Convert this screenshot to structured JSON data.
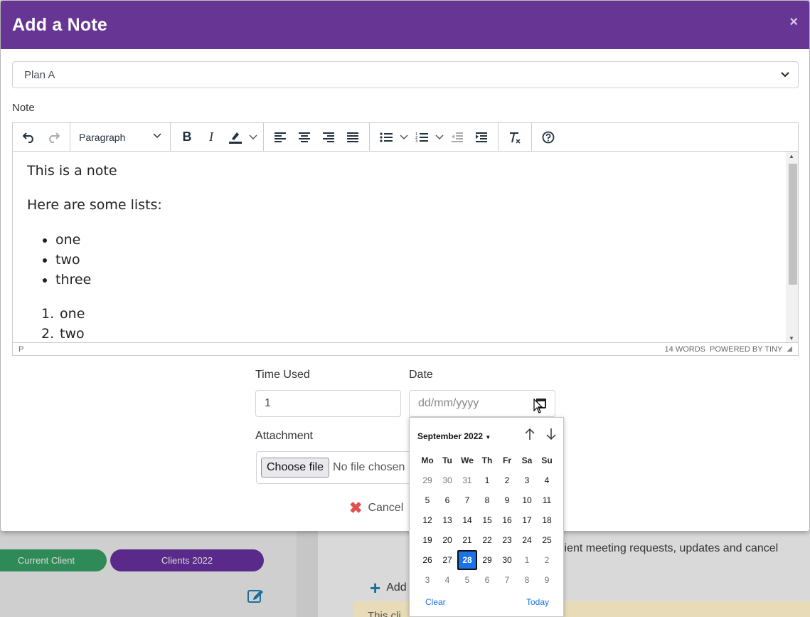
{
  "background": {
    "pill_current_client": "Current Client",
    "pill_clients_2022": "Clients 2022",
    "right_text": "lient meeting requests, updates and cancel",
    "add_text": "Add",
    "yellow_text": "This cli"
  },
  "modal": {
    "title": "Add a Note",
    "close": "×",
    "plan": {
      "selected": "Plan A"
    },
    "note_label": "Note",
    "editor": {
      "block_format": "Paragraph",
      "content": {
        "p1": "This is a note",
        "p2": "Here are some lists:",
        "bullets": [
          "one",
          "two",
          "three"
        ],
        "numbered": [
          {
            "num": "1.",
            "text": "one"
          },
          {
            "num": "2.",
            "text": "two"
          }
        ]
      },
      "status_path": "P",
      "word_count": "14 WORDS",
      "powered_by": "POWERED BY TINY"
    },
    "time_used": {
      "label": "Time Used",
      "value": "1"
    },
    "date": {
      "label": "Date",
      "placeholder": "dd/mm/yyyy"
    },
    "attachment": {
      "label": "Attachment",
      "button": "Choose file",
      "status": "No file chosen"
    },
    "cancel": "Cancel"
  },
  "datepicker": {
    "month": "September 2022",
    "weekdays": [
      "Mo",
      "Tu",
      "We",
      "Th",
      "Fr",
      "Sa",
      "Su"
    ],
    "weeks": [
      [
        {
          "d": "29",
          "m": true
        },
        {
          "d": "30",
          "m": true
        },
        {
          "d": "31",
          "m": true
        },
        {
          "d": "1"
        },
        {
          "d": "2"
        },
        {
          "d": "3"
        },
        {
          "d": "4"
        }
      ],
      [
        {
          "d": "5"
        },
        {
          "d": "6"
        },
        {
          "d": "7"
        },
        {
          "d": "8"
        },
        {
          "d": "9"
        },
        {
          "d": "10"
        },
        {
          "d": "11"
        }
      ],
      [
        {
          "d": "12"
        },
        {
          "d": "13"
        },
        {
          "d": "14"
        },
        {
          "d": "15"
        },
        {
          "d": "16"
        },
        {
          "d": "17"
        },
        {
          "d": "18"
        }
      ],
      [
        {
          "d": "19"
        },
        {
          "d": "20"
        },
        {
          "d": "21"
        },
        {
          "d": "22"
        },
        {
          "d": "23"
        },
        {
          "d": "24"
        },
        {
          "d": "25"
        }
      ],
      [
        {
          "d": "26"
        },
        {
          "d": "27"
        },
        {
          "d": "28",
          "s": true
        },
        {
          "d": "29"
        },
        {
          "d": "30"
        },
        {
          "d": "1",
          "m": true
        },
        {
          "d": "2",
          "m": true
        }
      ],
      [
        {
          "d": "3",
          "m": true
        },
        {
          "d": "4",
          "m": true
        },
        {
          "d": "5",
          "m": true
        },
        {
          "d": "6",
          "m": true
        },
        {
          "d": "7",
          "m": true
        },
        {
          "d": "8",
          "m": true
        },
        {
          "d": "9",
          "m": true
        }
      ]
    ],
    "clear": "Clear",
    "today": "Today"
  },
  "colors": {
    "header": "#673593",
    "selected_day": "#1a73e8",
    "pill_green": "#2e8b57",
    "pill_purple": "#5a2a8a"
  }
}
